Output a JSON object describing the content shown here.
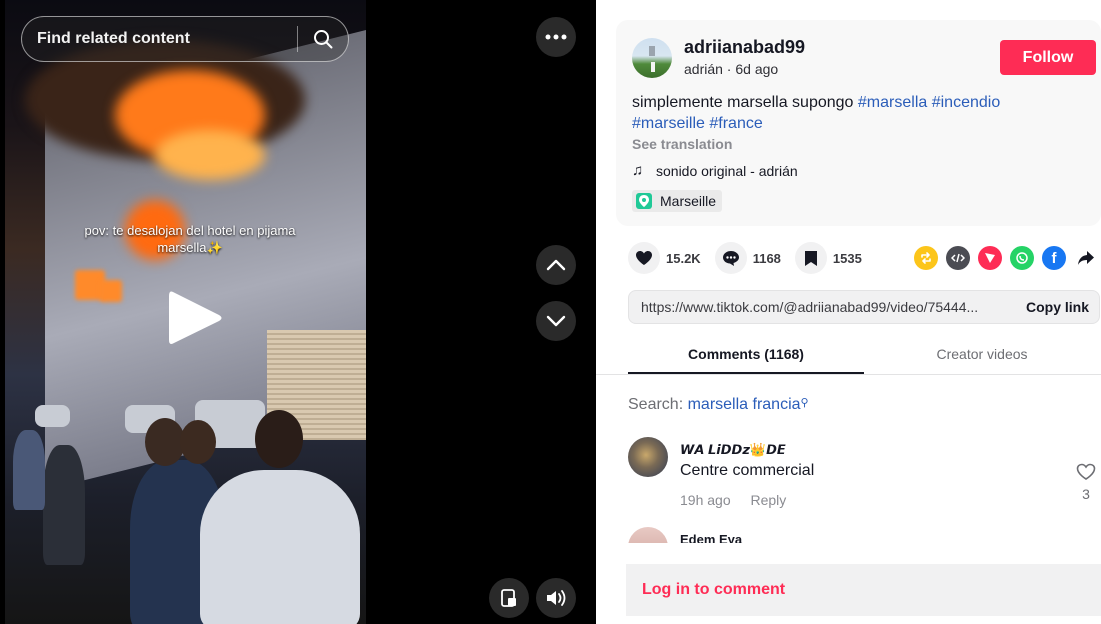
{
  "video": {
    "search_placeholder": "Find related content",
    "caption_line1": "pov: te desalojan del hotel en pijama",
    "caption_line2": "marsella✨"
  },
  "post": {
    "username": "adriianabad99",
    "display_name": "adrián",
    "time_ago": "6d ago",
    "follow_label": "Follow",
    "description_text": "simplemente marsella supongo",
    "hashtags": [
      "#marsella",
      "#incendio",
      "#marseille",
      "#france"
    ],
    "see_translation": "See translation",
    "music": "sonido original - adrián",
    "location": "Marseille"
  },
  "stats": {
    "likes": "15.2K",
    "comments": "1168",
    "bookmarks": "1535"
  },
  "share": {
    "link": "https://www.tiktok.com/@adriianabad99/video/75444...",
    "copy_label": "Copy link"
  },
  "tabs": {
    "comments": "Comments (1168)",
    "creator": "Creator videos"
  },
  "search_suggestion": {
    "prefix": "Search:",
    "term": "marsella francia"
  },
  "comments": [
    {
      "name": "𝙒𝘼 𝙇𝙞𝘿𝘿𝙯👑𝘿𝙀",
      "text": "Centre commercial",
      "time": "19h ago",
      "reply": "Reply",
      "likes": "3"
    },
    {
      "name": "Edem Eya"
    }
  ],
  "login_label": "Log in to comment",
  "colors": {
    "brand_red": "#fe2c55",
    "hashtag_blue": "#2b5db9",
    "panel_bg": "#f8f8f8"
  },
  "icons": [
    "search-icon",
    "more-icon",
    "chevron-up-icon",
    "chevron-down-icon",
    "play-icon",
    "pip-icon",
    "volume-icon",
    "heart-icon",
    "comment-icon",
    "bookmark-icon",
    "repost-icon",
    "embed-icon",
    "send-icon",
    "whatsapp-icon",
    "facebook-icon",
    "share-arrow-icon",
    "music-note-icon",
    "location-pin-icon"
  ]
}
